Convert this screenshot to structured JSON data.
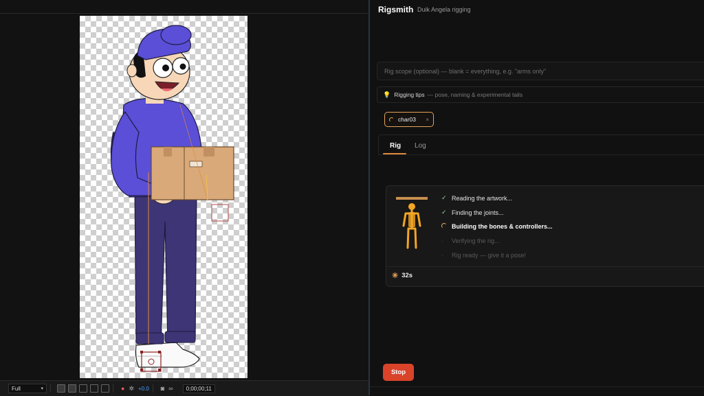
{
  "viewer": {
    "resolution": "Full",
    "exposure": "+0.0",
    "timecode": "0;00;00;11",
    "icons": [
      "region-icon",
      "transparency-grid-icon",
      "mask-icon",
      "guides-icon",
      "snapshot-region-icon",
      "color-channels-icon",
      "settings-icon",
      "camera-icon",
      "link-icon"
    ]
  },
  "panel": {
    "title": "Rigsmith",
    "subtitle": "Duik Angela rigging",
    "scope_placeholder": "Rig scope (optional) — blank = everything, e.g. \"arms only\"",
    "scope_value": "",
    "tips_title": "Rigging tips",
    "tips_desc": "— pose, naming & experimental tails",
    "chip_label": "char03",
    "chip_close": "×",
    "tabs": [
      {
        "label": "Rig",
        "active": true
      },
      {
        "label": "Log",
        "active": false
      }
    ],
    "steps": [
      {
        "label": "Reading the artwork...",
        "status": "done",
        "mark": "✓"
      },
      {
        "label": "Finding the joints...",
        "status": "done",
        "mark": "✓"
      },
      {
        "label": "Building the bones & controllers...",
        "status": "active",
        "mark": ""
      },
      {
        "label": "Verifying the rig...",
        "status": "pending",
        "mark": "·"
      },
      {
        "label": "Rig ready — give it a pose!",
        "status": "pending",
        "mark": "·"
      }
    ],
    "elapsed": "32s",
    "stop_label": "Stop"
  },
  "colors": {
    "accent": "#e7a45a",
    "stop": "#d9432a",
    "tab_underline": "#e08a3c"
  }
}
